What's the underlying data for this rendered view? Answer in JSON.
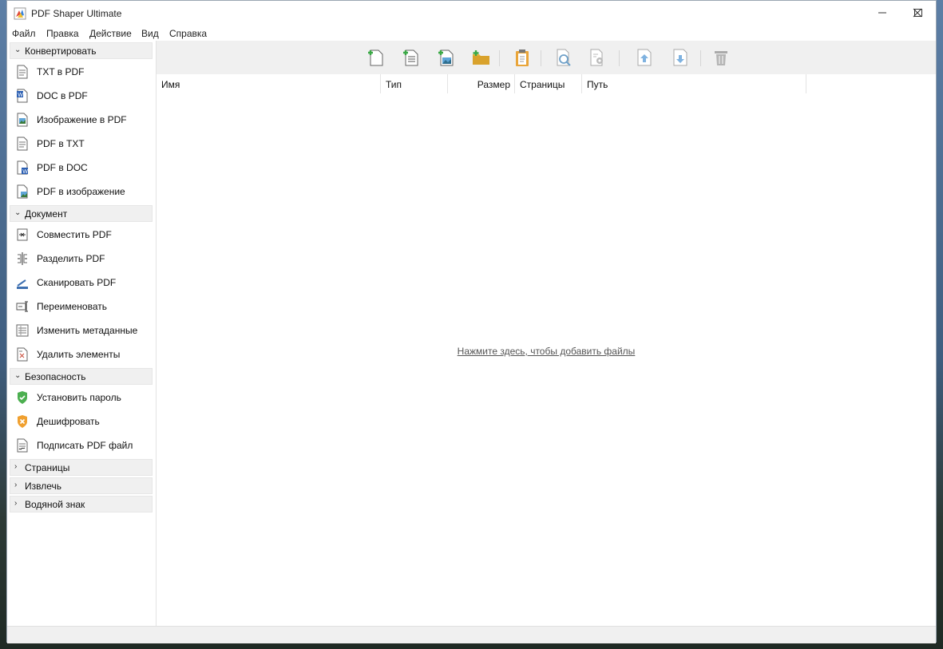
{
  "window": {
    "title": "PDF Shaper Ultimate"
  },
  "menu": [
    "Файл",
    "Правка",
    "Действие",
    "Вид",
    "Справка"
  ],
  "sidebar": {
    "groups": [
      {
        "label": "Конвертировать",
        "expanded": true,
        "items": [
          "TXT в PDF",
          "DOC в PDF",
          "Изображение в PDF",
          "PDF в TXT",
          "PDF в DOC",
          "PDF в изображение"
        ]
      },
      {
        "label": "Документ",
        "expanded": true,
        "items": [
          "Совместить PDF",
          "Разделить PDF",
          "Сканировать PDF",
          "Переименовать",
          "Изменить метаданные",
          "Удалить элементы"
        ]
      },
      {
        "label": "Безопасность",
        "expanded": true,
        "items": [
          "Установить пароль",
          "Дешифровать",
          "Подписать PDF файл"
        ]
      },
      {
        "label": "Страницы",
        "expanded": false
      },
      {
        "label": "Извлечь",
        "expanded": false
      },
      {
        "label": "Водяной знак",
        "expanded": false
      }
    ]
  },
  "table": {
    "columns": [
      "Имя",
      "Тип",
      "Размер",
      "Страницы",
      "Путь"
    ]
  },
  "empty_hint": "Нажмите здесь, чтобы добавить файлы",
  "colors": {
    "accent_green": "#3aa845",
    "folder": "#e2b13c",
    "shield_green": "#4caf50",
    "shield_orange": "#f0a030"
  }
}
